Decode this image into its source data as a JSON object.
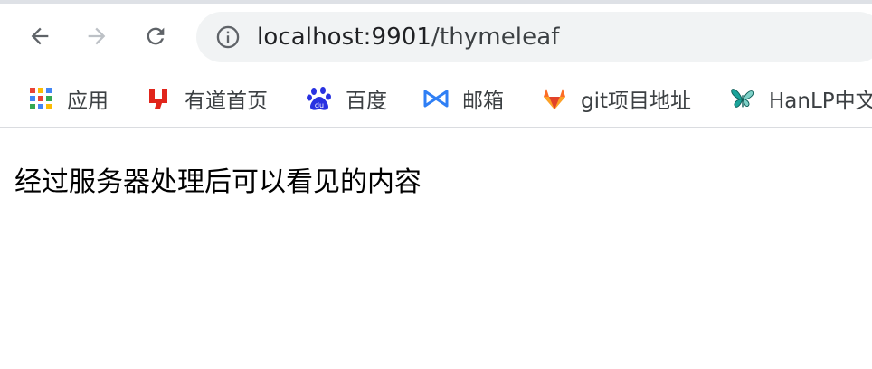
{
  "browser": {
    "url_host": "localhost:9901",
    "url_path": "/thymeleaf"
  },
  "bookmarks": [
    {
      "label": "应用",
      "icon": "apps-grid-icon"
    },
    {
      "label": "有道首页",
      "icon": "youdao-icon"
    },
    {
      "label": "百度",
      "icon": "baidu-paw-icon"
    },
    {
      "label": "邮箱",
      "icon": "mail-bowtie-icon"
    },
    {
      "label": "git项目地址",
      "icon": "gitlab-fox-icon"
    },
    {
      "label": "HanLP中文",
      "icon": "butterfly-icon"
    }
  ],
  "page": {
    "text": "经过服务器处理后可以看见的内容"
  },
  "colors": {
    "omnibox_bg": "#f1f3f4",
    "icon_gray": "#5f6368",
    "forward_disabled": "#bdc1c6",
    "youdao_red": "#e1251b",
    "baidu_blue": "#2932e1",
    "mail_blue": "#2f7ff5",
    "gitlab_orange": "#fc6d26",
    "hanlp_teal": "#1aa39a"
  }
}
